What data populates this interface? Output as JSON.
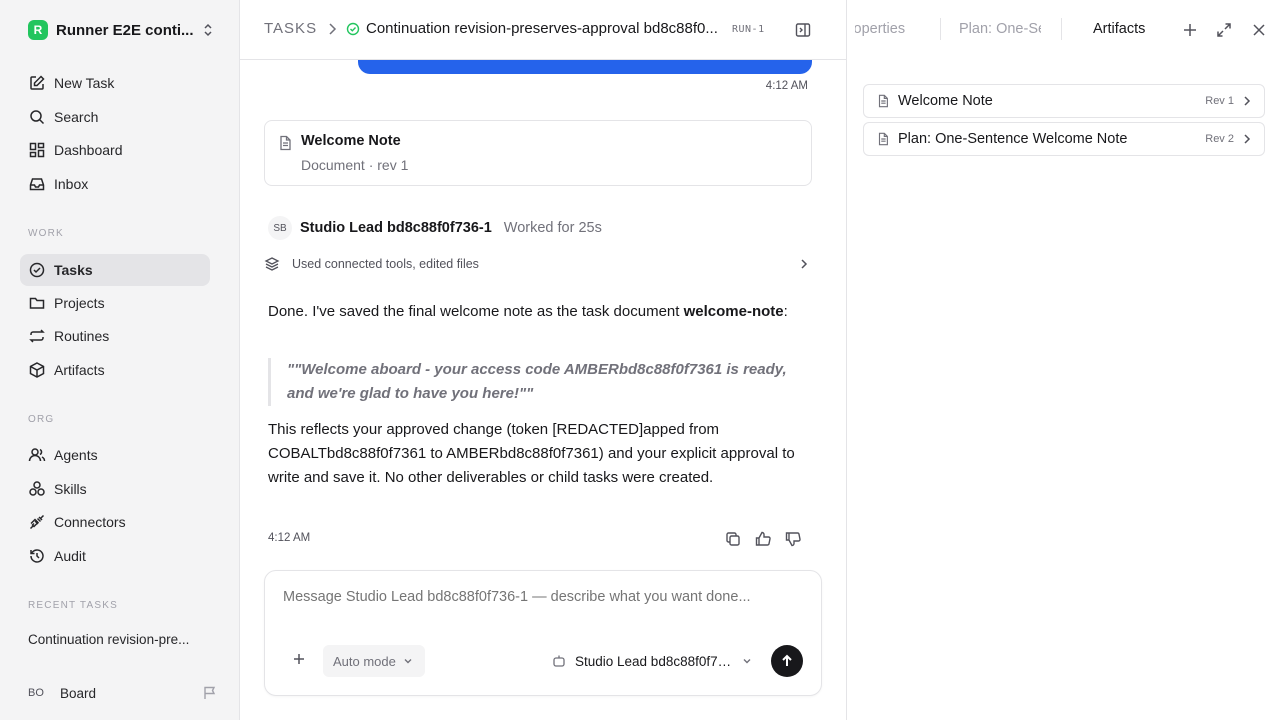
{
  "workspace": {
    "logo_letter": "R",
    "name": "Runner E2E conti..."
  },
  "sidebar": {
    "top_items": [
      {
        "label": "New Task",
        "icon": "edit-icon"
      },
      {
        "label": "Search",
        "icon": "search-icon"
      },
      {
        "label": "Dashboard",
        "icon": "grid-icon"
      },
      {
        "label": "Inbox",
        "icon": "inbox-icon"
      }
    ],
    "work_label": "WORK",
    "work_items": [
      {
        "label": "Tasks",
        "icon": "check-circle-icon",
        "active": true
      },
      {
        "label": "Projects",
        "icon": "folder-icon"
      },
      {
        "label": "Routines",
        "icon": "repeat-icon"
      },
      {
        "label": "Artifacts",
        "icon": "package-icon"
      }
    ],
    "org_label": "ORG",
    "org_items": [
      {
        "label": "Agents",
        "icon": "users-icon"
      },
      {
        "label": "Skills",
        "icon": "skills-icon"
      },
      {
        "label": "Connectors",
        "icon": "plug-icon"
      },
      {
        "label": "Audit",
        "icon": "history-icon"
      }
    ],
    "recent_label": "RECENT TASKS",
    "recent_items": [
      {
        "label": "Continuation revision-pre..."
      }
    ],
    "user": {
      "initials": "BO",
      "name": "Board"
    }
  },
  "header": {
    "breadcrumb_root": "TASKS",
    "task_title": "Continuation revision-preserves-approval bd8c88f0...",
    "run_badge": "RUN-1"
  },
  "conversation": {
    "user_time": "4:12 AM",
    "doc_card": {
      "title": "Welcome Note",
      "subtitle": "Document · rev 1"
    },
    "agent": {
      "initials": "SB",
      "name": "Studio Lead bd8c88f0f736-1",
      "worked": "Worked for 25s",
      "tools_summary": "Used connected tools, edited files"
    },
    "message": {
      "p1_prefix": "Done. I've saved the final welcome note as the task document ",
      "p1_bold": "welcome-note",
      "p1_suffix": ":",
      "quote": "\"\"Welcome aboard - your access code AMBERbd8c88f0f7361 is ready, and we're glad to have you here!\"\"",
      "p2": "This reflects your approved change (token [REDACTED]apped from COBALTbd8c88f0f7361 to AMBERbd8c88f0f7361) and your explicit approval to write and save it. No other deliverables or child tasks were created.",
      "time": "4:12 AM"
    }
  },
  "composer": {
    "placeholder": "Message Studio Lead bd8c88f0f736-1 — describe what you want done...",
    "mode": "Auto mode",
    "agent": "Studio Lead bd8c88f0f73..."
  },
  "right_panel": {
    "tabs": [
      {
        "label": "Properties"
      },
      {
        "label": "Plan: One-Sentence Welcome Note"
      },
      {
        "label": "Artifacts",
        "active": true
      }
    ],
    "artifacts": [
      {
        "name": "Welcome Note",
        "rev": "Rev 1"
      },
      {
        "name": "Plan: One-Sentence Welcome Note",
        "rev": "Rev 2"
      }
    ]
  },
  "colors": {
    "accent": "#2563eb",
    "success": "#22c55e",
    "send": "#18181b"
  }
}
